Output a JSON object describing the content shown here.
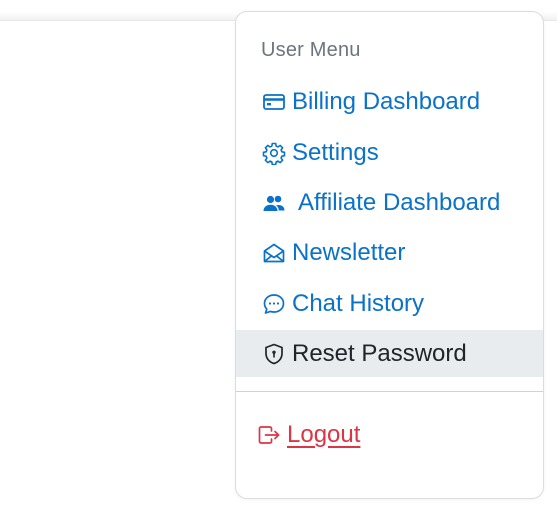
{
  "user_menu": {
    "header": "User Menu",
    "items": [
      {
        "label": "Billing Dashboard",
        "icon": "credit-card-icon"
      },
      {
        "label": "Settings",
        "icon": "gear-icon"
      },
      {
        "label": "Affiliate Dashboard",
        "icon": "people-icon"
      },
      {
        "label": "Newsletter",
        "icon": "envelope-open-icon"
      },
      {
        "label": "Chat History",
        "icon": "chat-dots-icon"
      },
      {
        "label": "Reset Password",
        "icon": "shield-lock-icon",
        "active": true
      }
    ],
    "logout": {
      "label": "Logout",
      "icon": "box-arrow-right-icon"
    }
  },
  "colors": {
    "link": "#0a72c8",
    "active_bg": "#e9ecef",
    "active_text": "#212529",
    "header": "#6c757d",
    "danger": "#dc3545"
  }
}
